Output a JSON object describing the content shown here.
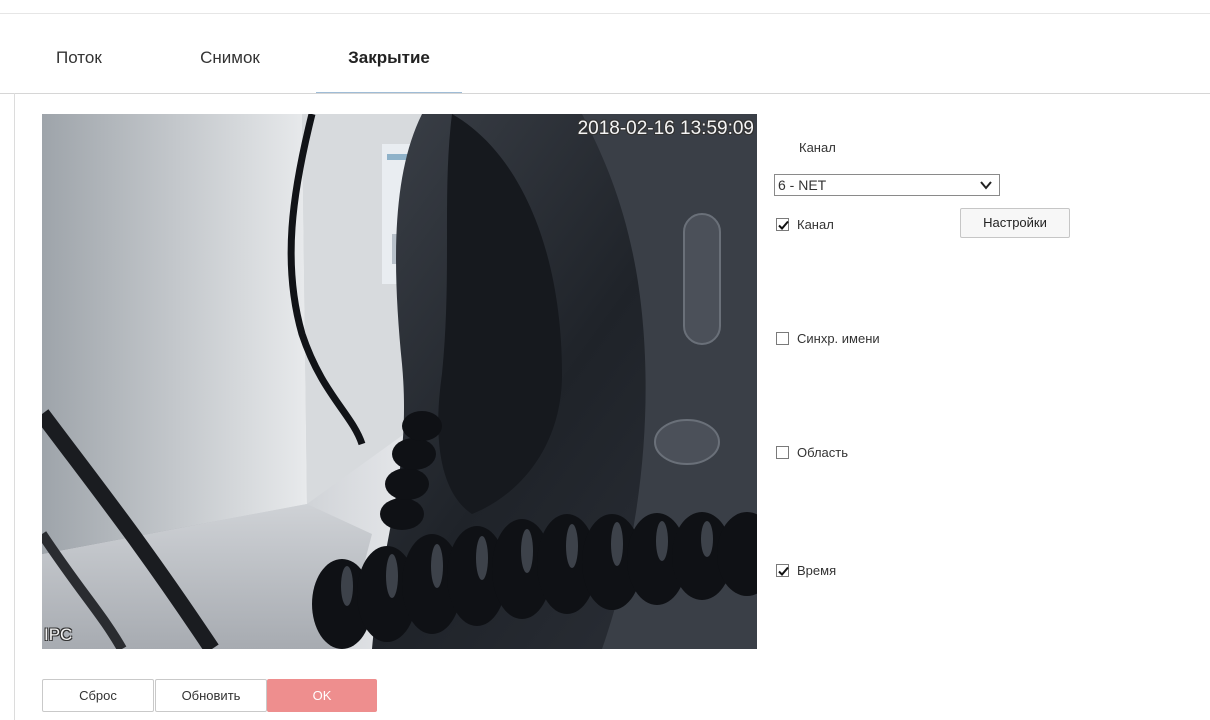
{
  "tabs": [
    {
      "label": "Поток",
      "active": false
    },
    {
      "label": "Снимок",
      "active": false
    },
    {
      "label": "Закрытие",
      "active": true
    }
  ],
  "camera": {
    "timestamp": "2018-02-16 13:59:09",
    "name_osd": "IPC"
  },
  "panel": {
    "channel_title": "Канал",
    "channel_selected": "6 - NET",
    "settings_button": "Настройки",
    "options": [
      {
        "label": "Канал",
        "checked": true
      },
      {
        "label": "Синхр. имени",
        "checked": false
      },
      {
        "label": "Область",
        "checked": false
      },
      {
        "label": "Время",
        "checked": true
      }
    ]
  },
  "buttons": {
    "reset": "Сброс",
    "refresh": "Обновить",
    "ok": "OK"
  },
  "colors": {
    "ok_button": "#ee8e8e",
    "tab_underline": "#9fbcd6"
  },
  "icons": [
    "chevron-down-icon",
    "checkmark-icon"
  ]
}
